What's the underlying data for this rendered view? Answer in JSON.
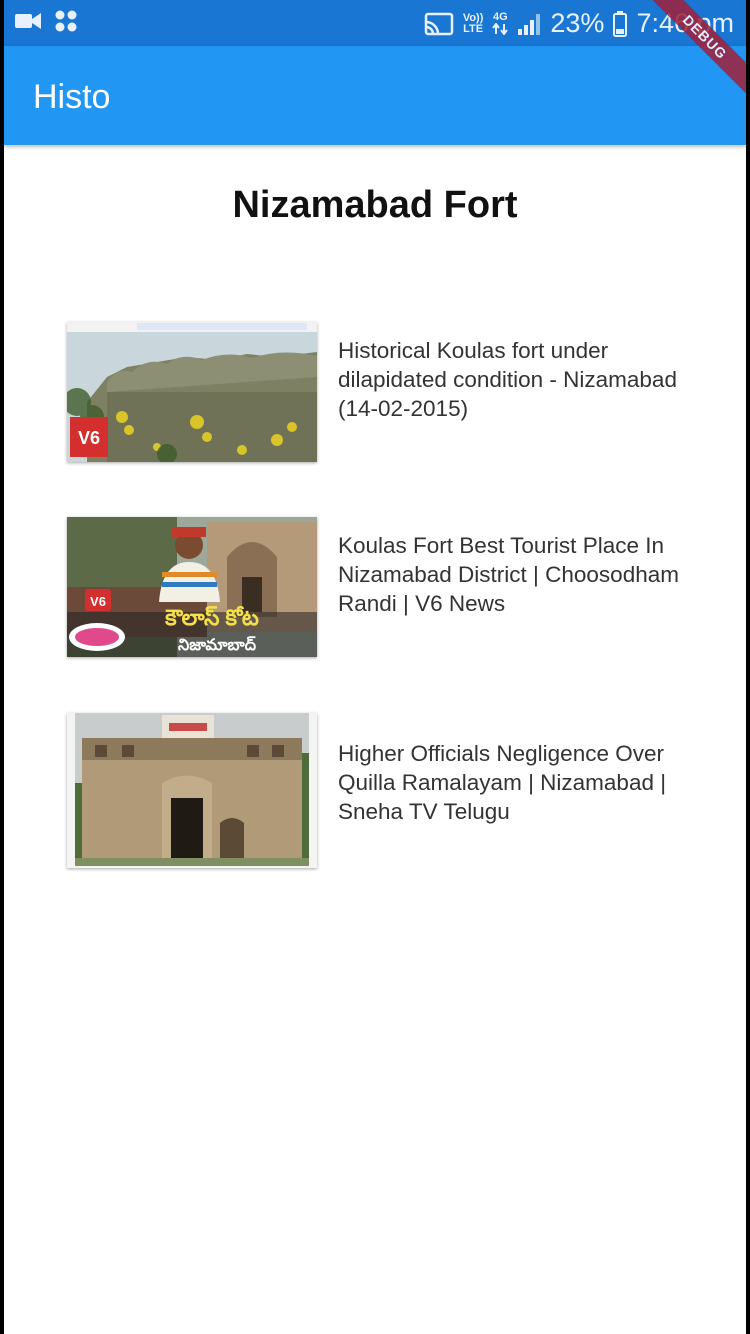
{
  "status_bar": {
    "volte_label": "Vo))\nLTE",
    "network_label": "4G",
    "battery_percent": "23%",
    "time": "7:46 pm",
    "icons": [
      "video-camera-icon",
      "apps-icon",
      "cast-icon",
      "volte-icon",
      "data-arrows-icon",
      "signal-icon",
      "battery-icon"
    ]
  },
  "debug_banner": "DEBUG",
  "app_bar": {
    "title": "Histo"
  },
  "page": {
    "title": "Nizamabad Fort"
  },
  "videos": [
    {
      "title": "Historical Koulas fort under dilapidated condition - Nizamabad (14-02-2015)",
      "thumbnail_overlay": "V6"
    },
    {
      "title": "Koulas Fort Best Tourist Place In Nizamabad District | Choosodham Randi | V6 News",
      "thumbnail_overlay": "V6"
    },
    {
      "title": "Higher Officials Negligence Over Quilla Ramalayam | Nizamabad | Sneha TV Telugu"
    }
  ],
  "colors": {
    "status_bar": "#1976d2",
    "app_bar": "#2196f3",
    "debug_banner": "#a0203a"
  }
}
